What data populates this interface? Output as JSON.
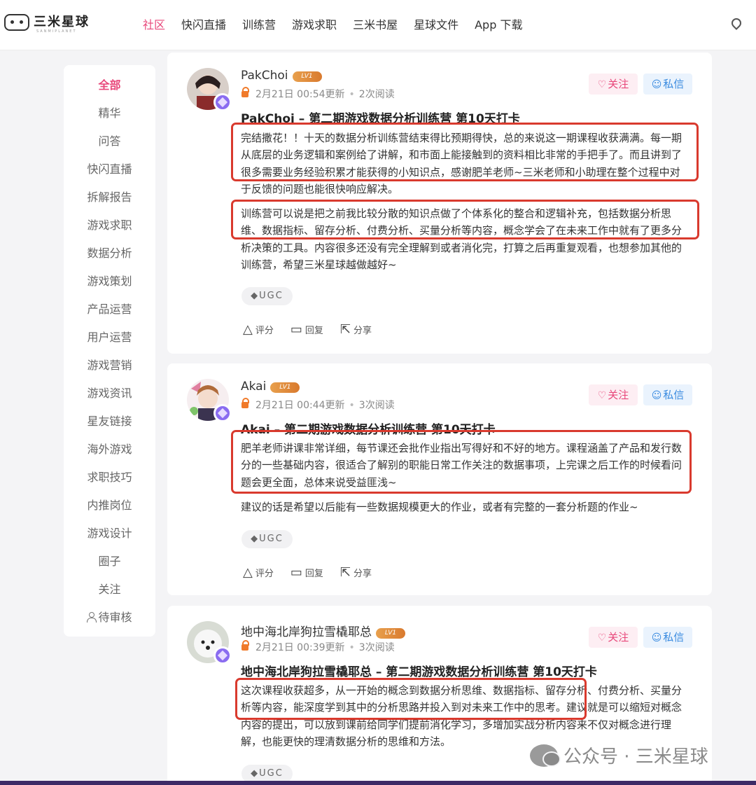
{
  "header": {
    "logo_text": "三米星球",
    "logo_subtext": "SANMIPLANET",
    "nav": [
      "社区",
      "快闪直播",
      "训练营",
      "游戏求职",
      "三米书屋",
      "星球文件",
      "App 下载"
    ]
  },
  "sidebar": {
    "items": [
      "全部",
      "精华",
      "问答",
      "快闪直播",
      "拆解报告",
      "游戏求职",
      "数据分析",
      "游戏策划",
      "产品运营",
      "用户运营",
      "游戏营销",
      "游戏资讯",
      "星友链接",
      "海外游戏",
      "求职技巧",
      "内推岗位",
      "游戏设计",
      "圈子",
      "关注",
      "待审核"
    ]
  },
  "posts": [
    {
      "username": "PakChoi",
      "level": "LV1",
      "date": "2月21日 00:54更新",
      "reads": "2次阅读",
      "follow": "关注",
      "message": "私信",
      "title": "PakChoi – 第二期游戏数据分析训练营 第10天打卡",
      "p1": "完结撒花！！十天的数据分析训练营结束得比预期得快，总的来说这一期课程收获满满。每一期从底层的业务逻辑和案例给了讲解，和市面上能接触到的资料相比非常的手把手了。而且讲到了很多需要业务经验积累才能获得的小知识点，感谢肥羊老师~三米老师和小助理在整个过程中对于反馈的问题也能很快响应解决。",
      "p2": "训练营可以说是把之前我比较分散的知识点做了个体系化的整合和逻辑补充，包括数据分析思维、数据指标、留存分析、付费分析、买量分析等内容，概念学会了在未来工作中就有了更多分析决策的工具。内容很多还没有完全理解到或者消化完，打算之后再重复观看，也想参加其他的训练营，希望三米星球越做越好~",
      "tag": "UGC",
      "actions": [
        "评分",
        "回复",
        "分享"
      ]
    },
    {
      "username": "Akai",
      "level": "LV1",
      "date": "2月21日 00:44更新",
      "reads": "3次阅读",
      "follow": "关注",
      "message": "私信",
      "title": "Akai – 第二期游戏数据分析训练营 第10天打卡",
      "p1": "肥羊老师讲课非常详细，每节课还会批作业指出写得好和不好的地方。课程涵盖了产品和发行数分的一些基础内容，很适合了解别的职能日常工作关注的数据事项，上完课之后工作的时候看问题会更全面，总体来说受益匪浅~",
      "p2": "建议的话是希望以后能有一些数据规模更大的作业，或者有完整的一套分析题的作业~",
      "tag": "UGC",
      "actions": [
        "评分",
        "回复",
        "分享"
      ]
    },
    {
      "username": "地中海北岸狗拉雪橇耶总",
      "level": "LV1",
      "date": "2月21日 00:39更新",
      "reads": "3次阅读",
      "follow": "关注",
      "message": "私信",
      "title": "地中海北岸狗拉雪橇耶总 – 第二期游戏数据分析训练营 第10天打卡",
      "p1": "这次课程收获超多，从一开始的概念到数据分析思维、数据指标、留存分析、付费分析、买量分析等内容，能深度学到其中的分析思路并投入到对未来工作中的思考。建议就是可以缩短对概念内容的提出，可以放到课前给同学们提前消化学习，多增加实战分析内容来不仅对概念进行理解，也能更快的理清数据分析的思维和方法。",
      "tag": "UGC"
    }
  ],
  "watermark": "公众号 · 三米星球"
}
